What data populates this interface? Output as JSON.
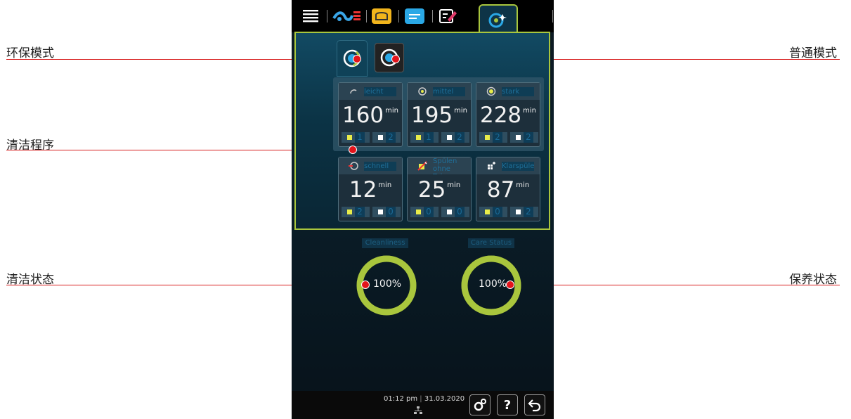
{
  "annotations": {
    "eco_mode": "环保模式",
    "cleaning_programs": "清洁程序",
    "cleanliness_status": "清洁状态",
    "normal_mode": "普通模式",
    "care_status": "保养状态"
  },
  "programs": [
    {
      "name": "leicht",
      "time": "160",
      "unit": "min",
      "tabs": "1",
      "caps": "2"
    },
    {
      "name": "mittel",
      "time": "195",
      "unit": "min",
      "tabs": "1",
      "caps": "2"
    },
    {
      "name": "stark",
      "time": "228",
      "unit": "min",
      "tabs": "2",
      "caps": "2"
    },
    {
      "name": "schnell",
      "time": "12",
      "unit": "min",
      "tabs": "2",
      "caps": "0"
    },
    {
      "name": "Spülen ohne Tabs",
      "time": "25",
      "unit": "min",
      "tabs": "0",
      "caps": "0"
    },
    {
      "name": "Klarspülen",
      "time": "87",
      "unit": "min",
      "tabs": "0",
      "caps": "2"
    }
  ],
  "gauges": {
    "cleanliness": {
      "label": "Cleanliness",
      "value": "100%",
      "fraction": 1.0
    },
    "care": {
      "label": "Care Status",
      "value": "100%",
      "fraction": 1.0
    }
  },
  "status": {
    "time": "01:12 pm",
    "date": "31.03.2020",
    "help": "?"
  },
  "colors": {
    "accent": "#a9c63d",
    "callout": "#d81e1e"
  },
  "icons": [
    "menu-icon",
    "cooking-paths-icon",
    "bread-icon",
    "notes-icon",
    "edit-icon",
    "care-cleaning-icon",
    "settings-icon",
    "help-icon",
    "back-icon",
    "network-icon"
  ]
}
